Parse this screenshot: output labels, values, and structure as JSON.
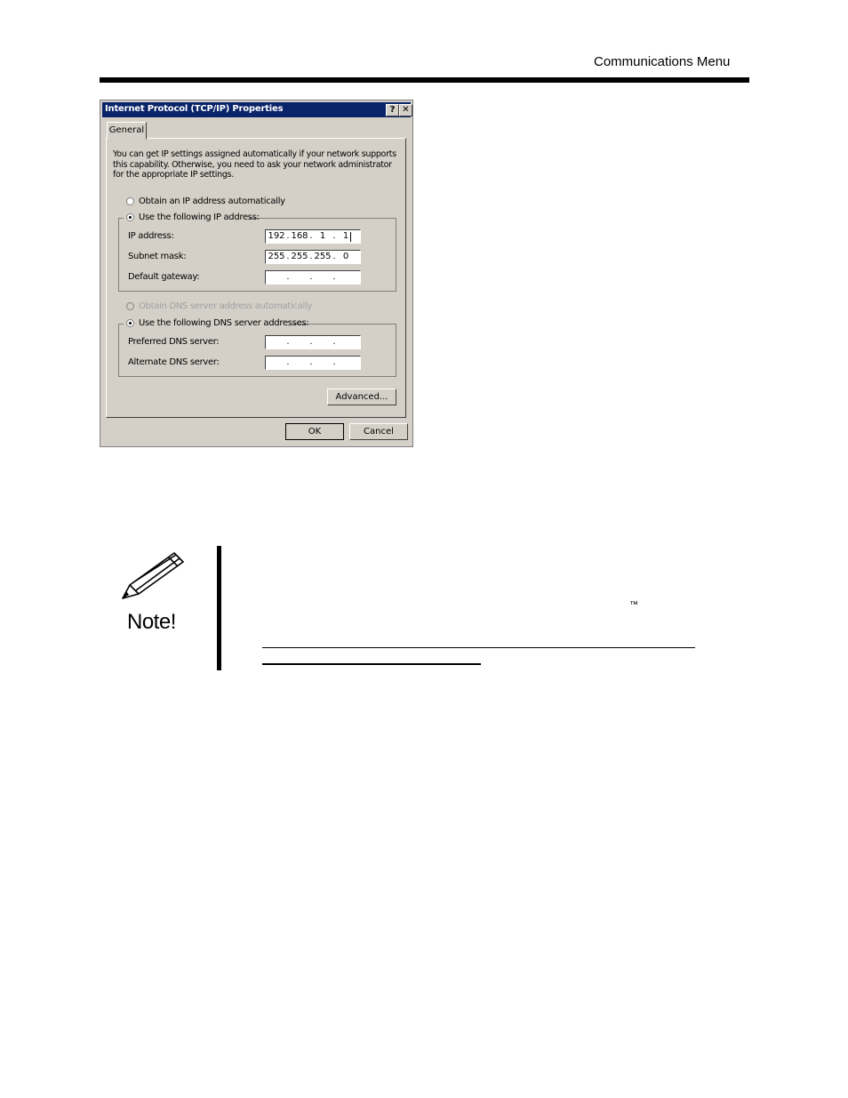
{
  "page_header": {
    "title": "Communications Menu"
  },
  "dialog": {
    "title": "Internet Protocol (TCP/IP) Properties",
    "help_glyph": "?",
    "close_glyph": "✕",
    "tab_label": "General",
    "intro_text": "You can get IP settings assigned automatically if your network supports this capability. Otherwise, you need to ask your network administrator for the appropriate IP settings.",
    "ip_auto_label": "Obtain an IP address automatically",
    "ip_manual_label": "Use the following IP address:",
    "ip_address_label": "IP address:",
    "ip_address": [
      "192",
      "168",
      "1",
      "1"
    ],
    "subnet_label": "Subnet mask:",
    "subnet_mask": [
      "255",
      "255",
      "255",
      "0"
    ],
    "gateway_label": "Default gateway:",
    "dns_auto_label": "Obtain DNS server address automatically",
    "dns_manual_label": "Use the following DNS server addresses:",
    "preferred_dns_label": "Preferred DNS server:",
    "alternate_dns_label": "Alternate DNS server:",
    "advanced_label": "Advanced...",
    "ok_label": "OK",
    "cancel_label": "Cancel",
    "dot_char": "."
  },
  "note": {
    "label": "Note!",
    "tm": "™"
  }
}
